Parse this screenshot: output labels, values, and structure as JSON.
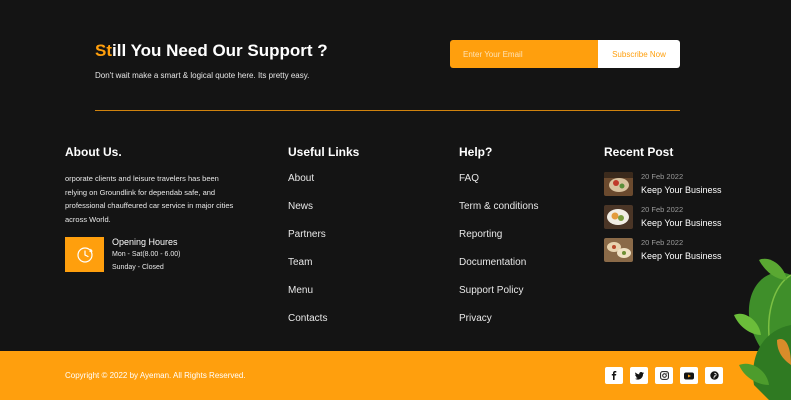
{
  "support": {
    "title_accent": "St",
    "title_rest": "ill You Need Our Support ?",
    "subtitle": "Don't wait make a smart & logical quote here. Its pretty easy.",
    "email_placeholder": "Enter Your Email",
    "subscribe_label": "Subscribe Now"
  },
  "about": {
    "heading": "About Us.",
    "text": "orporate clients and leisure travelers has been relying on Groundlink for dependab safe, and professional chauffeured car service in major cities across World.",
    "hours_title": "Opening Houres",
    "hours_weekday": "Mon - Sat(8.00 - 6.00)",
    "hours_sunday": "Sunday - Closed"
  },
  "useful_links": {
    "heading": "Useful Links",
    "items": [
      "About",
      "News",
      "Partners",
      "Team",
      "Menu",
      "Contacts"
    ]
  },
  "help": {
    "heading": "Help?",
    "items": [
      "FAQ",
      "Term & conditions",
      "Reporting",
      "Documentation",
      "Support Policy",
      "Privacy"
    ]
  },
  "recent_post": {
    "heading": "Recent Post",
    "posts": [
      {
        "date": "20 Feb 2022",
        "title": "Keep Your Business"
      },
      {
        "date": "20 Feb 2022",
        "title": "Keep Your Business"
      },
      {
        "date": "20 Feb 2022",
        "title": "Keep Your Business"
      }
    ]
  },
  "bottom": {
    "copyright": "Copyright © 2022 by Ayeman. All Rights Reserved.",
    "socials": [
      "facebook-icon",
      "twitter-icon",
      "instagram-icon",
      "youtube-icon",
      "pinterest-icon"
    ]
  },
  "colors": {
    "accent": "#ff9f0d",
    "background": "#141414"
  }
}
